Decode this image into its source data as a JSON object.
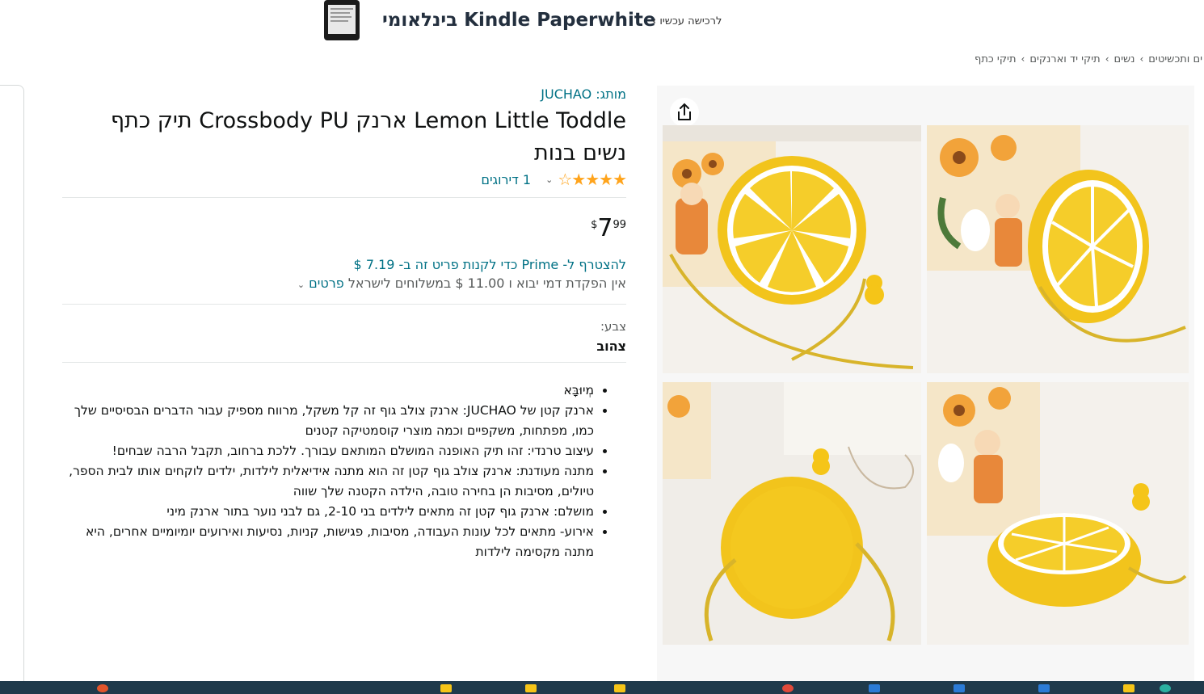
{
  "banner": {
    "title": "Kindle Paperwhite בינלאומי",
    "cta": "לרכישה עכשיו ›"
  },
  "breadcrumb": [
    "ים ותכשיטים",
    "נשים",
    "תיקי יד וארנקים",
    "תיקי כתף"
  ],
  "product": {
    "brand": "מותג: JUCHAO",
    "title": "Lemon Little Toddle ארנק Crossbody PU תיק כתף נשים בנות",
    "stars": 4.5,
    "rating_count": "1 דירוגים",
    "price_symbol": "$",
    "price_whole": "7",
    "price_fraction": "99",
    "prime_offer": "להצטרף ל- Prime כדי לקנות פריט זה ב- 7.19 $",
    "shipping_text": "אין הפקדת דמי יבוא ו 11.00 $ במשלוחים לישראל",
    "shipping_details": "פרטים",
    "color_label": "צבע:",
    "color_value": "צהוב",
    "bullets": [
      "מְיוּבָּא",
      "ארנק קטן של JUCHAO: ארנק צולב גוף זה קל משקל, מרווח מספיק עבור הדברים הבסיסיים שלך כמו, מפתחות, משקפיים וכמה מוצרי קוסמטיקה קטנים",
      "עיצוב טרנדי: זהו תיק האופנה המושלם המותאם עבורך. ללכת ברחוב, תקבל הרבה שבחים!",
      "מתנה מעודנת: ארנק צולב גוף קטן זה הוא מתנה אידיאלית לילדות, ילדים לוקחים אותו לבית הספר, טיולים, מסיבות הן בחירה טובה, הילדה הקטנה שלך שווה",
      "מושלם: ארנק גוף קטן זה מתאים לילדים בני 2-10, גם לבני נוער בתור ארנק מיני",
      "אירוע- מתאים לכל עונות העבודה, מסיבות, פגישות, קניות, נסיעות ואירועים יומיומיים אחרים, היא מתנה מקסימה לילדות"
    ]
  },
  "icons": {
    "share": "share-icon",
    "star": "star-icon",
    "caret": "chevron-down-icon"
  },
  "colors": {
    "link": "#007185",
    "star": "#ffa41c",
    "lemon": "#f5c518",
    "taskbar": "#1f3a4b"
  }
}
